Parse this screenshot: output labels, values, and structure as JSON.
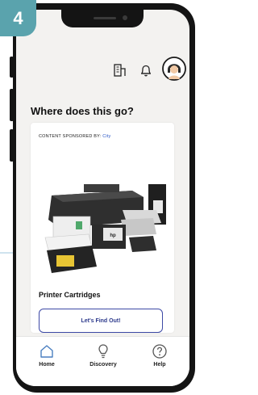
{
  "step": {
    "number": "4"
  },
  "header": {
    "icons": [
      "building-icon",
      "bell-icon",
      "avatar"
    ]
  },
  "page": {
    "title": "Where does this go?"
  },
  "card": {
    "sponsor_prefix": "CONTENT SPONSORED BY:",
    "sponsor_name": "City",
    "product_name": "Printer Cartridges",
    "cta_label": "Let's Find Out!",
    "product_labels": [
      "hp"
    ]
  },
  "nav": {
    "items": [
      {
        "label": "Home",
        "icon": "home-icon"
      },
      {
        "label": "Discovery",
        "icon": "lightbulb-icon"
      },
      {
        "label": "Help",
        "icon": "help-icon"
      }
    ]
  },
  "colors": {
    "accent_teal": "#5aa3ad",
    "cta_border": "#3d49a5",
    "nav_icon": "#4a7fc0",
    "screen_bg": "#f3f2f0"
  }
}
